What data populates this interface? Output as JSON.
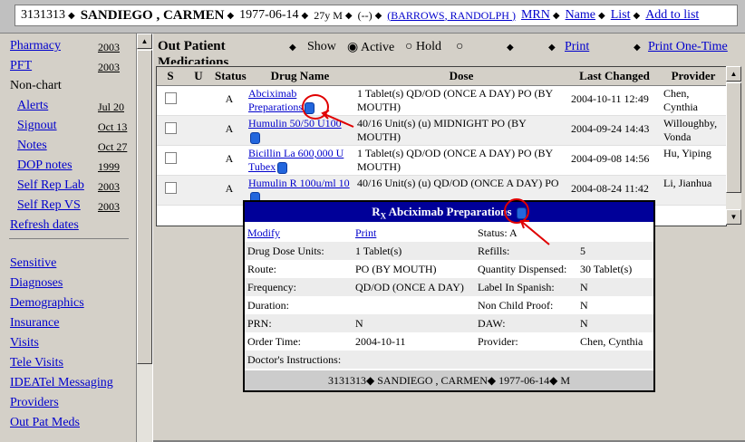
{
  "header": {
    "mrn": "3131313",
    "patient_name": "SANDIEGO , CARMEN",
    "dob": "1977-06-14",
    "age_sex": "27y M",
    "flag": "(--)",
    "provider": "(BARROWS, RANDOLPH )",
    "links": [
      "MRN",
      "Name",
      "List",
      "Add to list"
    ]
  },
  "nav": {
    "items": [
      {
        "label": "Pharmacy",
        "date": "2003",
        "indent": false,
        "link": true
      },
      {
        "label": "PFT",
        "date": "2003",
        "indent": false,
        "link": true
      },
      {
        "label": "Non-chart",
        "date": "",
        "indent": false,
        "link": false
      },
      {
        "label": "Alerts",
        "date": "Jul 20",
        "indent": true,
        "link": true
      },
      {
        "label": "Signout",
        "date": "Oct 13",
        "indent": true,
        "link": true
      },
      {
        "label": "Notes",
        "date": "Oct 27",
        "indent": true,
        "link": true
      },
      {
        "label": "DOP notes",
        "date": "1999",
        "indent": true,
        "link": true
      },
      {
        "label": "Self Rep Lab",
        "date": "2003",
        "indent": true,
        "link": true
      },
      {
        "label": "Self Rep VS",
        "date": "2003",
        "indent": true,
        "link": true
      },
      {
        "label": "Refresh dates",
        "date": "",
        "indent": false,
        "link": true
      },
      {
        "label": "Sensitive",
        "date": "",
        "indent": false,
        "link": true
      },
      {
        "label": "Diagnoses",
        "date": "",
        "indent": false,
        "link": true
      },
      {
        "label": "Demographics",
        "date": "",
        "indent": false,
        "link": true
      },
      {
        "label": "Insurance",
        "date": "",
        "indent": false,
        "link": true
      },
      {
        "label": "Visits",
        "date": "",
        "indent": false,
        "link": true
      },
      {
        "label": "Tele Visits",
        "date": "",
        "indent": false,
        "link": true
      },
      {
        "label": "IDEATel Messaging",
        "date": "",
        "indent": false,
        "link": true
      },
      {
        "label": "Providers",
        "date": "",
        "indent": false,
        "link": true
      },
      {
        "label": "Out Pat Meds",
        "date": "",
        "indent": false,
        "link": true
      }
    ]
  },
  "toolbar": {
    "title": "Out Patient",
    "title2": "Medications",
    "show_label": "Show",
    "opt_active": "Active",
    "opt_hold": "Hold",
    "print": "Print",
    "print_one_time": "Print One-Time"
  },
  "table": {
    "headers": [
      "S",
      "U",
      "Status",
      "Drug Name",
      "Dose",
      "Last Changed",
      "Provider"
    ],
    "rows": [
      {
        "status": "A",
        "drug": "Abciximab Preparations",
        "dose": "1 Tablet(s) QD/OD (ONCE A DAY) PO (BY MOUTH)",
        "changed": "2004-10-11 12:49",
        "provider": "Chen, Cynthia"
      },
      {
        "status": "A",
        "drug": "Humulin 50/50 U100",
        "dose": "40/16 Unit(s) (u) MIDNIGHT PO (BY MOUTH)",
        "changed": "2004-09-24 14:43",
        "provider": "Willoughby, Vonda"
      },
      {
        "status": "A",
        "drug": "Bicillin La 600,000 U Tubex",
        "dose": "1 Tablet(s) QD/OD (ONCE A DAY) PO (BY MOUTH)",
        "changed": "2004-09-08 14:56",
        "provider": "Hu, Yiping"
      },
      {
        "status": "A",
        "drug": "Humulin R 100u/ml 10",
        "dose": "40/16 Unit(s) (u) QD/OD (ONCE A DAY) PO",
        "changed": "2004-08-24 11:42",
        "provider": "Li, Jianhua"
      }
    ]
  },
  "popup": {
    "rx": "R",
    "rx_sub": "X",
    "title": "Abciximab Preparations",
    "modify": "Modify",
    "print": "Print",
    "status": "Status: A",
    "fields": [
      {
        "l1": "Drug Dose Units:",
        "v1": "1 Tablet(s)",
        "l2": "Refills:",
        "v2": "5"
      },
      {
        "l1": "Route:",
        "v1": "PO (BY MOUTH)",
        "l2": "Quantity Dispensed:",
        "v2": "30 Tablet(s)"
      },
      {
        "l1": "Frequency:",
        "v1": "QD/OD (ONCE A DAY)",
        "l2": "Label In Spanish:",
        "v2": "N"
      },
      {
        "l1": "Duration:",
        "v1": "",
        "l2": "Non Child Proof:",
        "v2": "N"
      },
      {
        "l1": "PRN:",
        "v1": "N",
        "l2": "DAW:",
        "v2": "N"
      },
      {
        "l1": "Order Time:",
        "v1": "2004-10-11",
        "l2": "Provider:",
        "v2": "Chen, Cynthia"
      },
      {
        "l1": "Doctor's Instructions:",
        "v1": "",
        "l2": "",
        "v2": ""
      }
    ],
    "footer": "3131313◆  SANDIEGO , CARMEN◆  1977-06-14◆  M"
  },
  "colors": {
    "accent": "#000099",
    "annotation": "#e00000",
    "link": "#0000cc"
  }
}
